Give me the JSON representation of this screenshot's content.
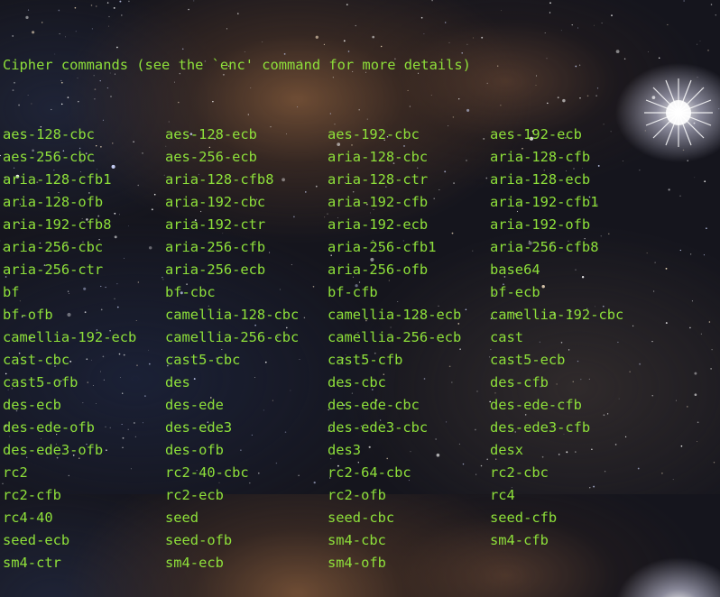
{
  "terminal": {
    "header": "Cipher commands (see the `enc' command for more details)",
    "ciphers": [
      "aes-128-cbc",
      "aes-128-ecb",
      "aes-192-cbc",
      "aes-192-ecb",
      "aes-256-cbc",
      "aes-256-ecb",
      "aria-128-cbc",
      "aria-128-cfb",
      "aria-128-cfb1",
      "aria-128-cfb8",
      "aria-128-ctr",
      "aria-128-ecb",
      "aria-128-ofb",
      "aria-192-cbc",
      "aria-192-cfb",
      "aria-192-cfb1",
      "aria-192-cfb8",
      "aria-192-ctr",
      "aria-192-ecb",
      "aria-192-ofb",
      "aria-256-cbc",
      "aria-256-cfb",
      "aria-256-cfb1",
      "aria-256-cfb8",
      "aria-256-ctr",
      "aria-256-ecb",
      "aria-256-ofb",
      "base64",
      "bf",
      "bf-cbc",
      "bf-cfb",
      "bf-ecb",
      "bf-ofb",
      "camellia-128-cbc",
      "camellia-128-ecb",
      "camellia-192-cbc",
      "camellia-192-ecb",
      "camellia-256-cbc",
      "camellia-256-ecb",
      "cast",
      "cast-cbc",
      "cast5-cbc",
      "cast5-cfb",
      "cast5-ecb",
      "cast5-ofb",
      "des",
      "des-cbc",
      "des-cfb",
      "des-ecb",
      "des-ede",
      "des-ede-cbc",
      "des-ede-cfb",
      "des-ede-ofb",
      "des-ede3",
      "des-ede3-cbc",
      "des-ede3-cfb",
      "des-ede3-ofb",
      "des-ofb",
      "des3",
      "desx",
      "rc2",
      "rc2-40-cbc",
      "rc2-64-cbc",
      "rc2-cbc",
      "rc2-cfb",
      "rc2-ecb",
      "rc2-ofb",
      "rc4",
      "rc4-40",
      "seed",
      "seed-cbc",
      "seed-cfb",
      "seed-ecb",
      "seed-ofb",
      "sm4-cbc",
      "sm4-cfb",
      "sm4-ctr",
      "sm4-ecb",
      "sm4-ofb"
    ]
  },
  "colors": {
    "text": "#8ee03a",
    "background": "#15151d"
  },
  "icons": {
    "background": "starfield-wallpaper"
  }
}
